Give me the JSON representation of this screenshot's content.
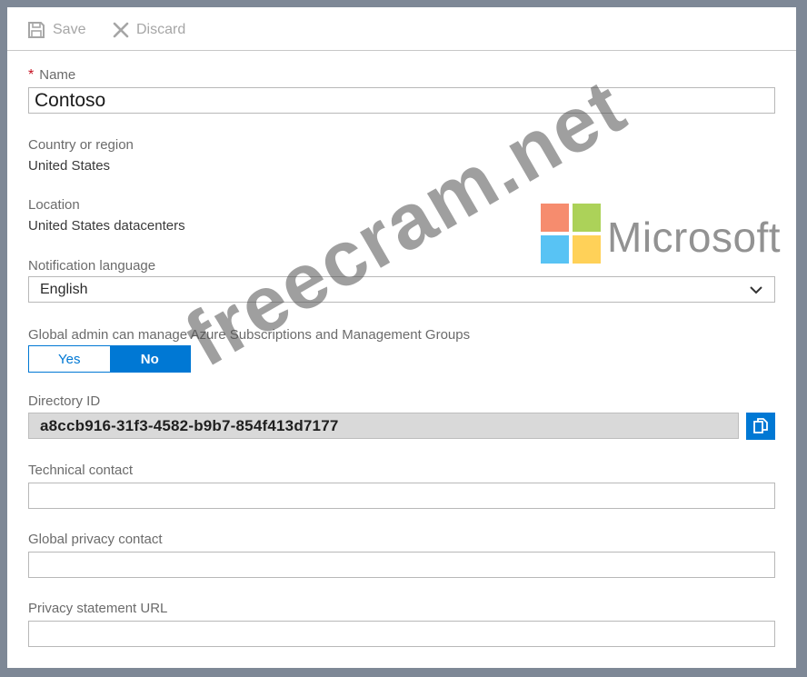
{
  "toolbar": {
    "save_label": "Save",
    "discard_label": "Discard"
  },
  "form": {
    "name": {
      "required_mark": "*",
      "label": "Name",
      "value": "Contoso"
    },
    "country": {
      "label": "Country or region",
      "value": "United States"
    },
    "location": {
      "label": "Location",
      "value": "United States datacenters"
    },
    "notification_language": {
      "label": "Notification language",
      "selected": "English"
    },
    "global_admin": {
      "label": "Global admin can manage Azure Subscriptions and Management Groups",
      "options": [
        "Yes",
        "No"
      ],
      "selected": "No"
    },
    "directory_id": {
      "label": "Directory ID",
      "value": "a8ccb916-31f3-4582-b9b7-854f413d7177"
    },
    "technical_contact": {
      "label": "Technical contact",
      "value": ""
    },
    "global_privacy_contact": {
      "label": "Global privacy contact",
      "value": ""
    },
    "privacy_statement_url": {
      "label": "Privacy statement URL",
      "value": ""
    }
  },
  "watermark": {
    "text": "freecram.net",
    "brand": "Microsoft",
    "logo_colors": [
      "#f25022",
      "#7fba00",
      "#00a4ef",
      "#ffb900"
    ]
  },
  "colors": {
    "accent": "#0078d4",
    "required": "#c50f1f"
  }
}
